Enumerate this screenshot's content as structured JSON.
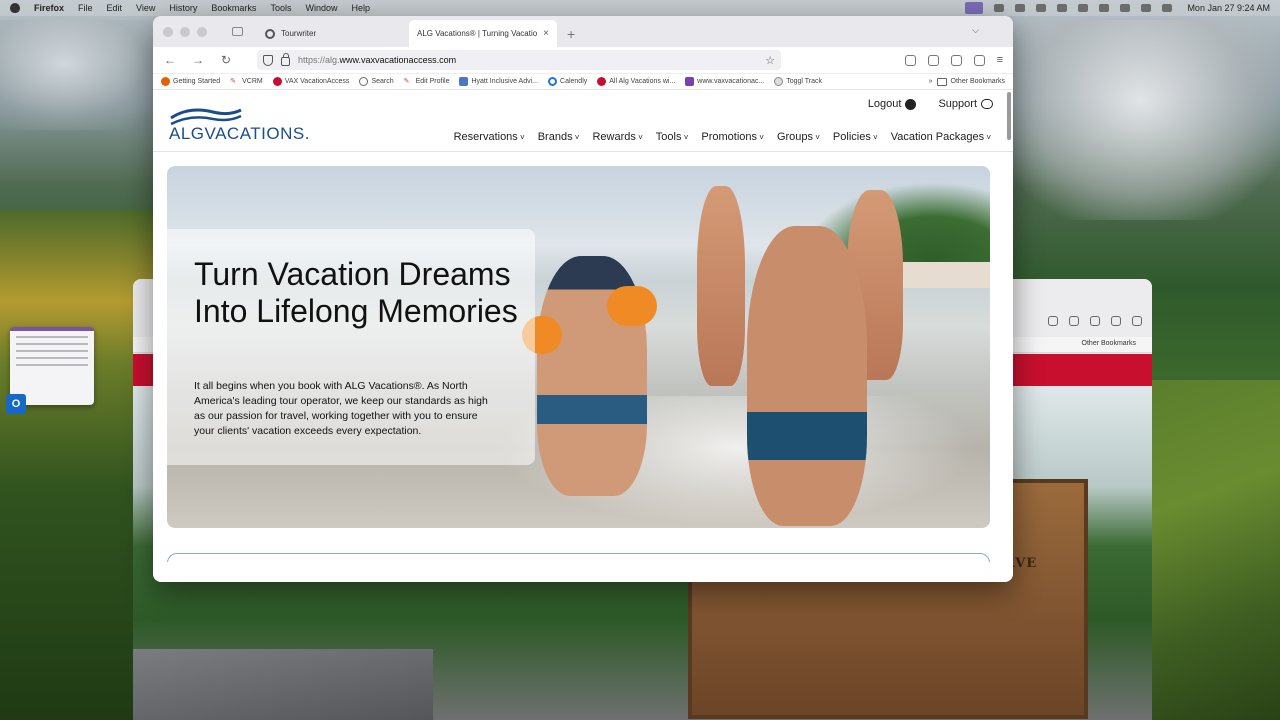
{
  "menubar": {
    "app": "Firefox",
    "items": [
      "File",
      "Edit",
      "View",
      "History",
      "Bookmarks",
      "Tools",
      "Window",
      "Help"
    ],
    "clock": "Mon Jan 27  9:24 AM"
  },
  "browser": {
    "tabs": [
      {
        "title": "Tourwriter"
      },
      {
        "title": "ALG Vacations® | Turning Vacation D",
        "close": "×"
      }
    ],
    "new_tab": "+",
    "url": {
      "prefix": "https://alg.",
      "host": "www.vaxvacationaccess.com"
    },
    "bookmarks": [
      {
        "label": "Getting Started",
        "icon": "firefox-icon"
      },
      {
        "label": "VCRM",
        "icon": "pen-icon"
      },
      {
        "label": "VAX VacationAccess",
        "icon": "vax-icon"
      },
      {
        "label": "Search",
        "icon": "globe-icon"
      },
      {
        "label": "Edit Profile",
        "icon": "pen-icon"
      },
      {
        "label": "Hyatt Inclusive Advi...",
        "icon": "hyatt-icon"
      },
      {
        "label": "Calendly",
        "icon": "calendly-icon"
      },
      {
        "label": "All Alg Vacations wi...",
        "icon": "vax-icon"
      },
      {
        "label": "www.vaxvacationac...",
        "icon": "purple-icon"
      },
      {
        "label": "Toggl Track",
        "icon": "toggl-icon"
      }
    ],
    "other_bookmarks": "Other Bookmarks"
  },
  "site": {
    "logo_text": "ALGVACATIONS.",
    "logout": "Logout",
    "support": "Support",
    "nav": [
      "Reservations",
      "Brands",
      "Rewards",
      "Tools",
      "Promotions",
      "Groups",
      "Policies",
      "Vacation Packages"
    ],
    "hero": {
      "title": "Turn Vacation Dreams Into Lifelong Memories",
      "text": "It all begins when you book with ALG Vacations®. As North America's leading tour operator, we keep our standards as high as our passion for travel, working together with you to ensure your clients' vacation exceeds every expectation."
    }
  },
  "back_window": {
    "other_bookmarks": "Other Bookmarks",
    "sign_text": "ERVE"
  },
  "colors": {
    "brand_blue": "#1a4e8a",
    "vax_red": "#c8102e"
  }
}
